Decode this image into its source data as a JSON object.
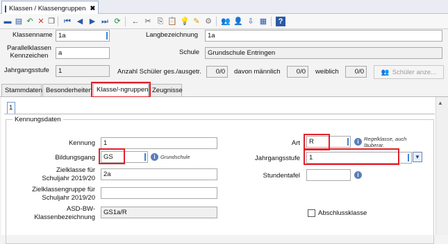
{
  "window": {
    "tab_title": "Klassen / Klassengruppen",
    "close_glyph": "✖"
  },
  "toolbar": {
    "icons": [
      "save-icon",
      "save-as-icon",
      "undo-icon",
      "delete-icon",
      "copy-icon",
      "nav-first-icon",
      "nav-prev-icon",
      "nav-next-icon",
      "nav-last-icon",
      "refresh-icon",
      "back-icon",
      "cut-icon",
      "copy-clip-icon",
      "paste-icon",
      "lightbulb-icon",
      "edit-icon",
      "settings-icon",
      "users-icon",
      "user-icon",
      "import-icon",
      "calendar-icon",
      "help-icon"
    ]
  },
  "header": {
    "klassenname_label": "Klassenname",
    "klassenname_value": "1a",
    "langbezeichnung_label": "Langbezeichnung",
    "langbezeichnung_value": "1a",
    "parallel_label_1": "Parallelklassen",
    "parallel_label_2": "Kennzeichen",
    "parallel_value": "a",
    "schule_label": "Schule",
    "schule_value": "Grundschule Entringen",
    "jahrgang_label": "Jahrgangsstufe",
    "jahrgang_value": "1",
    "anzahl_label": "Anzahl Schüler ges./ausgetr.",
    "anzahl_value": "0/0",
    "maennlich_label": "davon männlich",
    "maennlich_value": "0/0",
    "weiblich_label": "weiblich",
    "weiblich_value": "0/0",
    "schueler_button": "Schüler anze..."
  },
  "tabs": [
    {
      "label": "Stammdaten"
    },
    {
      "label": "Besonderheiten"
    },
    {
      "label": "Klasse/-ngruppen"
    },
    {
      "label": "Zeugnisse"
    }
  ],
  "subtab": {
    "label": "1"
  },
  "kennungsdaten": {
    "group_title": "Kennungsdaten",
    "kennung_label": "Kennung",
    "kennung_value": "1",
    "bildungsgang_label": "Bildungsgang",
    "bildungsgang_value": "GS",
    "bildungsgang_hint": "Grundschule",
    "zielklasse_label_1": "Zielklasse für",
    "zielklasse_label_2": "Schuljahr 2019/20",
    "zielklasse_value": "2a",
    "zielgruppe_label_1": "Zielklassengruppe für",
    "zielgruppe_label_2": "Schuljahr 2019/20",
    "zielgruppe_value": "",
    "asd_label_1": "ASD-BW-",
    "asd_label_2": "Klassenbezeichnung",
    "asd_value": "GS1a/R",
    "art_label": "Art",
    "art_value": "R",
    "art_hint_1": "Regelklasse, auch",
    "art_hint_2": "läuberar.",
    "jahrgang_label": "Jahrgangsstufe",
    "jahrgang_value": "1",
    "stundentafel_label": "Stundentafel",
    "stundentafel_value": "",
    "abschluss_label": "Abschlussklasse"
  },
  "colors": {
    "highlight": "#e0202a",
    "accent": "#3a86d6"
  }
}
